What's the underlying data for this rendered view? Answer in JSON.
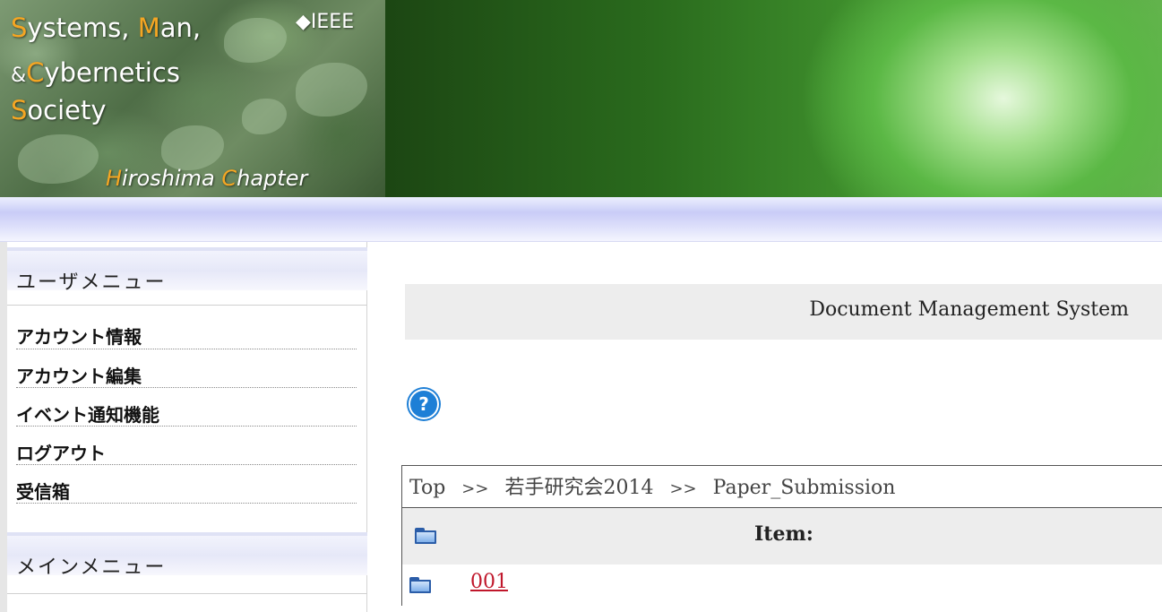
{
  "banner": {
    "logo": {
      "line1": [
        {
          "cap": "S",
          "rest": "ystems, "
        },
        {
          "cap": "M",
          "rest": "an,"
        }
      ],
      "line2_amp": "&",
      "line2": {
        "cap": "C",
        "rest": "ybernetics"
      },
      "line3": {
        "cap": "S",
        "rest": "ociety"
      },
      "ieee": "◆IEEE",
      "chapter": [
        {
          "cap": "H",
          "rest": "iroshima "
        },
        {
          "cap": "C",
          "rest": "hapter"
        }
      ]
    },
    "accent_color": "#f5a623"
  },
  "sidebar": {
    "user_menu_title": "ユーザメニュー",
    "user_menu_items": [
      "アカウント情報",
      "アカウント編集",
      "イベント通知機能",
      "ログアウト",
      "受信箱"
    ],
    "main_menu_title": "メインメニュー"
  },
  "main": {
    "title": "Document Management System",
    "help_icon": "help-icon",
    "breadcrumb": [
      "Top",
      "若手研究会2014",
      "Paper_Submission"
    ],
    "breadcrumb_separator": ">>",
    "table": {
      "header_label": "Item:",
      "header_icon": "folder-icon",
      "items": [
        {
          "label": "001",
          "icon": "folder-icon"
        }
      ],
      "link_color": "#c0172b"
    }
  }
}
